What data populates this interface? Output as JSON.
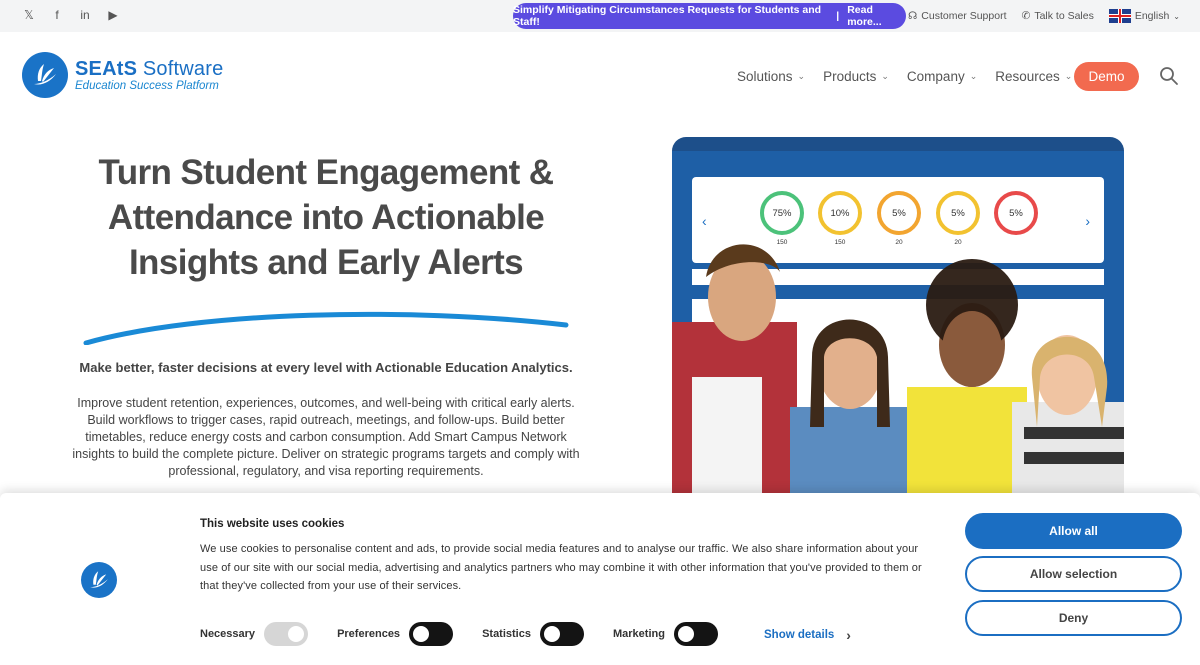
{
  "topbar": {
    "social": [
      {
        "icon": "x-icon",
        "glyph": "𝕏"
      },
      {
        "icon": "facebook-icon",
        "glyph": "f"
      },
      {
        "icon": "linkedin-icon",
        "glyph": "in"
      },
      {
        "icon": "youtube-icon",
        "glyph": "▶"
      }
    ],
    "promo_text": "Simplify Mitigating Circumstances Requests for Students and Staff!",
    "promo_sep": "|",
    "promo_link": "Read more...",
    "support": "Customer Support",
    "sales": "Talk to Sales",
    "language": "English"
  },
  "header": {
    "logo_brand": "SEAtS",
    "logo_software": " Software",
    "logo_tagline": "Education Success Platform",
    "nav": [
      "Solutions",
      "Products",
      "Company",
      "Resources"
    ],
    "demo": "Demo"
  },
  "hero": {
    "title_lines": [
      "Turn Student Engagement &",
      "Attendance into Actionable",
      "Insights and Early Alerts"
    ],
    "subtitle": "Make better, faster decisions at every level with Actionable Education Analytics.",
    "body": "Improve student retention, experiences, outcomes, and well-being with critical early alerts. Build workflows to trigger cases, rapid outreach, meetings, and follow-ups. Build better timetables, reduce energy costs and carbon consumption. Add Smart Campus Network insights to build the complete picture. Deliver on strategic programs targets and comply with professional, regulatory, and visa reporting requirements.",
    "dashboard_rings": [
      {
        "pct": "75%",
        "count": "150",
        "color": "#4cc27a"
      },
      {
        "pct": "10%",
        "count": "150",
        "color": "#f2c230"
      },
      {
        "pct": "5%",
        "count": "20",
        "color": "#f2a530"
      },
      {
        "pct": "5%",
        "count": "20",
        "color": "#f2c230"
      },
      {
        "pct": "5%",
        "count": "",
        "color": "#e84a4a"
      }
    ]
  },
  "cookie": {
    "title": "This website uses cookies",
    "text": "We use cookies to personalise content and ads, to provide social media features and to analyse our traffic. We also share information about your use of our site with our social media, advertising and analytics partners who may combine it with other information that you've provided to them or that they've collected from your use of their services.",
    "toggles": [
      {
        "label": "Necessary",
        "on": true
      },
      {
        "label": "Preferences",
        "on": false
      },
      {
        "label": "Statistics",
        "on": false
      },
      {
        "label": "Marketing",
        "on": false
      }
    ],
    "show_details": "Show details",
    "allow_all": "Allow all",
    "allow_selection": "Allow selection",
    "deny": "Deny"
  },
  "colors": {
    "brand_blue": "#1b6ec2",
    "promo_purple": "#5b4be0",
    "demo_orange": "#f26a4f"
  }
}
